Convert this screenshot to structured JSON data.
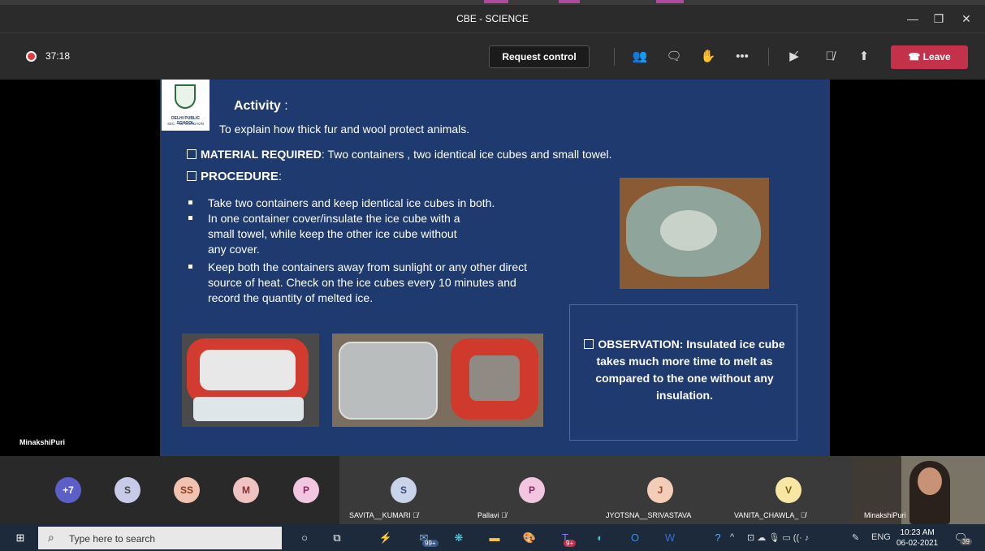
{
  "window": {
    "title": "CBE - SCIENCE"
  },
  "meeting": {
    "timer": "37:18",
    "request_control_label": "Request control",
    "leave_label": "Leave",
    "presenter_name": "MinakshiPuri"
  },
  "slide": {
    "logo_line1": "DELHI PUBLIC SCHOOL",
    "logo_line2": "SEC – 45, GURGAON",
    "activity_title": "Activity",
    "activity_colon": ":",
    "explain": "To explain how thick fur and wool protect animals.",
    "material_label": "MATERIAL REQUIRED",
    "material_text": ": Two containers , two identical  ice cubes and small towel.",
    "procedure_label": "PROCEDURE",
    "procedure_colon": ":",
    "step1": "Take two containers and keep identical ice cubes in both.",
    "step2_l1": "In one container cover/insulate the ice cube with a",
    "step2_l2": "small towel, while keep the other ice cube without",
    "step2_l3": "any cover.",
    "step3_l1": "Keep both the containers away from sunlight or any other direct",
    "step3_l2": "source of heat. Check on the ice cubes every 10 minutes and",
    "step3_l3": "record the quantity of melted ice.",
    "observation_label": "OBSERVATION:",
    "observation_text": " Insulated ice cube takes much more time to melt as compared to the  one without any insulation."
  },
  "participants": {
    "overflow": "+7",
    "mini": [
      {
        "initials": "S",
        "color": "#c7cbe8"
      },
      {
        "initials": "SS",
        "color": "#f2c2b0"
      },
      {
        "initials": "M",
        "color": "#f0c3c3"
      },
      {
        "initials": "P",
        "color": "#f2c6e0"
      }
    ],
    "tiles": [
      {
        "initials": "S",
        "name": "SAVITA__KUMARI",
        "color": "#c9d3ea",
        "muted": true
      },
      {
        "initials": "P",
        "name": "Pallavi",
        "color": "#f2c6e0",
        "muted": true
      },
      {
        "initials": "J",
        "name": "JYOTSNA__SRIVASTAVA",
        "color": "#f3cdb7",
        "muted": false
      },
      {
        "initials": "V",
        "name": "VANITA_CHAWLA_",
        "color": "#f7e6a4",
        "muted": true
      }
    ],
    "self_name": "MinakshiPuri"
  },
  "taskbar": {
    "search_placeholder": "Type here to search",
    "mail_badge": "99+",
    "teams_badge": "9+",
    "language": "ENG",
    "time": "10:23 AM",
    "date": "06-02-2021",
    "notifications": "39"
  },
  "colors": {
    "leave": "#c4314b",
    "slide_bg": "#1e3a6e",
    "record": "#e03a3e"
  }
}
